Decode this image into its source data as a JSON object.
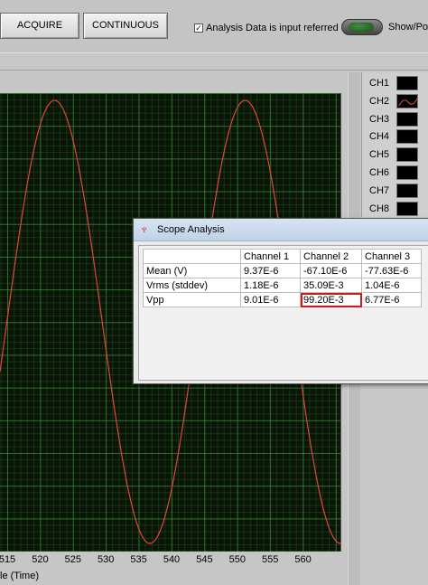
{
  "toolbar": {
    "acquire_label": "ACQUIRE",
    "continuous_label": "CONTINUOUS",
    "checkbox_label": "Analysis Data is input referred",
    "checkbox_checked": true,
    "toggle_label": "Show/Po"
  },
  "graph": {
    "x_ticks": [
      "515",
      "520",
      "525",
      "530",
      "535",
      "540",
      "545",
      "550",
      "555",
      "560"
    ],
    "x_label": "le (Time)",
    "trace_color": "#e0473a",
    "grid_color": "#3ca03c",
    "background_color": "#0a1508"
  },
  "legend": {
    "channels": [
      {
        "label": "CH1",
        "icon": "blank-swatch"
      },
      {
        "label": "CH2",
        "icon": "sine-wave-swatch"
      },
      {
        "label": "CH3",
        "icon": "blank-swatch"
      },
      {
        "label": "CH4",
        "icon": "blank-swatch"
      },
      {
        "label": "CH5",
        "icon": "blank-swatch"
      },
      {
        "label": "CH6",
        "icon": "blank-swatch"
      },
      {
        "label": "CH7",
        "icon": "blank-swatch"
      },
      {
        "label": "CH8",
        "icon": "blank-swatch"
      }
    ]
  },
  "dialog": {
    "title": "Scope Analysis",
    "icon": "ti-logo-icon",
    "columns": [
      "",
      "Channel 1",
      "Channel 2",
      "Channel 3"
    ],
    "rows": [
      {
        "label": "Mean (V)",
        "values": [
          "9.37E-6",
          "-67.10E-6",
          "-77.63E-6"
        ]
      },
      {
        "label": "Vrms (stddev)",
        "values": [
          "1.18E-6",
          "35.09E-3",
          "1.04E-6"
        ]
      },
      {
        "label": "Vpp",
        "values": [
          "9.01E-6",
          "99.20E-3",
          "6.77E-6"
        ]
      }
    ],
    "highlight_color": "#d01818"
  }
}
